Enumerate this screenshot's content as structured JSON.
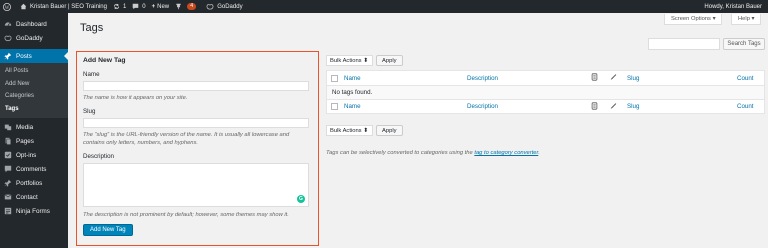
{
  "adminbar": {
    "site_name": "Kristan Bauer | SEO Training",
    "updates_count": "1",
    "comments_count": "0",
    "new_label": "New",
    "plugin_badge": "4",
    "godaddy_label": "GoDaddy",
    "howdy": "Howdy, Kristan Bauer"
  },
  "sidebar": {
    "items": [
      {
        "label": "Dashboard",
        "icon": "dashboard-icon"
      },
      {
        "label": "GoDaddy",
        "icon": "godaddy-icon"
      },
      {
        "label": "Posts",
        "icon": "pin-icon"
      },
      {
        "label": "Media",
        "icon": "media-icon"
      },
      {
        "label": "Pages",
        "icon": "pages-icon"
      },
      {
        "label": "Opt-ins",
        "icon": "optins-icon"
      },
      {
        "label": "Comments",
        "icon": "comments-icon"
      },
      {
        "label": "Portfolios",
        "icon": "portfolio-icon"
      },
      {
        "label": "Contact",
        "icon": "mail-icon"
      },
      {
        "label": "Ninja Forms",
        "icon": "forms-icon"
      }
    ],
    "posts_submenu": [
      "All Posts",
      "Add New",
      "Categories",
      "Tags"
    ]
  },
  "page": {
    "title": "Tags",
    "screen_options": "Screen Options ▾",
    "help": "Help ▾",
    "search_button": "Search Tags"
  },
  "add_tag": {
    "heading": "Add New Tag",
    "name_label": "Name",
    "name_help": "The name is how it appears on your site.",
    "slug_label": "Slug",
    "slug_help": "The “slug” is the URL-friendly version of the name. It is usually all lowercase and contains only letters, numbers, and hyphens.",
    "description_label": "Description",
    "description_help": "The description is not prominent by default; however, some themes may show it.",
    "submit": "Add New Tag"
  },
  "list": {
    "bulk_actions": "Bulk Actions ⬍",
    "apply": "Apply",
    "columns": {
      "name": "Name",
      "description": "Description",
      "slug": "Slug",
      "count": "Count"
    },
    "empty": "No tags found.",
    "note_prefix": "Tags can be selectively converted to categories using the ",
    "note_link": "tag to category converter",
    "note_suffix": "."
  },
  "colors": {
    "accent": "#0073aa",
    "highlight_border": "#e8532c",
    "sidebar_bg": "#23282d"
  }
}
